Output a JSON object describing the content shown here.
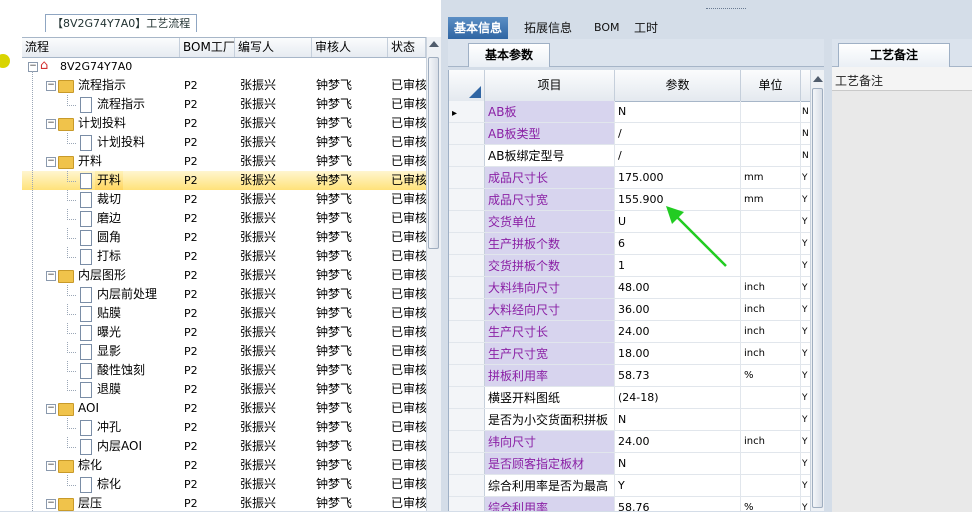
{
  "tree_panel": {
    "tab_title": "【8V2G74Y7A0】工艺流程",
    "columns": [
      "流程",
      "BOM工厂",
      "编写人",
      "审核人",
      "状态"
    ],
    "rows": [
      {
        "name": "8V2G74Y7A0",
        "level": 0,
        "kind": "root",
        "bom": "",
        "writer": "",
        "reviewer": "",
        "status": ""
      },
      {
        "name": "流程指示",
        "level": 1,
        "kind": "folder",
        "bom": "P2",
        "writer": "张振兴",
        "reviewer": "钟梦飞",
        "status": "已审核"
      },
      {
        "name": "流程指示",
        "level": 2,
        "kind": "doc",
        "bom": "P2",
        "writer": "张振兴",
        "reviewer": "钟梦飞",
        "status": "已审核"
      },
      {
        "name": "计划投料",
        "level": 1,
        "kind": "folder",
        "bom": "P2",
        "writer": "张振兴",
        "reviewer": "钟梦飞",
        "status": "已审核"
      },
      {
        "name": "计划投料",
        "level": 2,
        "kind": "doc",
        "bom": "P2",
        "writer": "张振兴",
        "reviewer": "钟梦飞",
        "status": "已审核"
      },
      {
        "name": "开料",
        "level": 1,
        "kind": "folder",
        "bom": "P2",
        "writer": "张振兴",
        "reviewer": "钟梦飞",
        "status": "已审核"
      },
      {
        "name": "开料",
        "level": 2,
        "kind": "doc",
        "bom": "P2",
        "writer": "张振兴",
        "reviewer": "钟梦飞",
        "status": "已审核",
        "selected": true
      },
      {
        "name": "裁切",
        "level": 2,
        "kind": "doc",
        "bom": "P2",
        "writer": "张振兴",
        "reviewer": "钟梦飞",
        "status": "已审核"
      },
      {
        "name": "磨边",
        "level": 2,
        "kind": "doc",
        "bom": "P2",
        "writer": "张振兴",
        "reviewer": "钟梦飞",
        "status": "已审核"
      },
      {
        "name": "圆角",
        "level": 2,
        "kind": "doc",
        "bom": "P2",
        "writer": "张振兴",
        "reviewer": "钟梦飞",
        "status": "已审核"
      },
      {
        "name": "打标",
        "level": 2,
        "kind": "doc",
        "bom": "P2",
        "writer": "张振兴",
        "reviewer": "钟梦飞",
        "status": "已审核"
      },
      {
        "name": "内层图形",
        "level": 1,
        "kind": "folder",
        "bom": "P2",
        "writer": "张振兴",
        "reviewer": "钟梦飞",
        "status": "已审核"
      },
      {
        "name": "内层前处理",
        "level": 2,
        "kind": "doc",
        "bom": "P2",
        "writer": "张振兴",
        "reviewer": "钟梦飞",
        "status": "已审核"
      },
      {
        "name": "贴膜",
        "level": 2,
        "kind": "doc",
        "bom": "P2",
        "writer": "张振兴",
        "reviewer": "钟梦飞",
        "status": "已审核"
      },
      {
        "name": "曝光",
        "level": 2,
        "kind": "doc",
        "bom": "P2",
        "writer": "张振兴",
        "reviewer": "钟梦飞",
        "status": "已审核"
      },
      {
        "name": "显影",
        "level": 2,
        "kind": "doc",
        "bom": "P2",
        "writer": "张振兴",
        "reviewer": "钟梦飞",
        "status": "已审核"
      },
      {
        "name": "酸性蚀刻",
        "level": 2,
        "kind": "doc",
        "bom": "P2",
        "writer": "张振兴",
        "reviewer": "钟梦飞",
        "status": "已审核"
      },
      {
        "name": "退膜",
        "level": 2,
        "kind": "doc",
        "bom": "P2",
        "writer": "张振兴",
        "reviewer": "钟梦飞",
        "status": "已审核"
      },
      {
        "name": "AOI",
        "level": 1,
        "kind": "folder",
        "bom": "P2",
        "writer": "张振兴",
        "reviewer": "钟梦飞",
        "status": "已审核"
      },
      {
        "name": "冲孔",
        "level": 2,
        "kind": "doc",
        "bom": "P2",
        "writer": "张振兴",
        "reviewer": "钟梦飞",
        "status": "已审核"
      },
      {
        "name": "内层AOI",
        "level": 2,
        "kind": "doc",
        "bom": "P2",
        "writer": "张振兴",
        "reviewer": "钟梦飞",
        "status": "已审核"
      },
      {
        "name": "棕化",
        "level": 1,
        "kind": "folder",
        "bom": "P2",
        "writer": "张振兴",
        "reviewer": "钟梦飞",
        "status": "已审核"
      },
      {
        "name": "棕化",
        "level": 2,
        "kind": "doc",
        "bom": "P2",
        "writer": "张振兴",
        "reviewer": "钟梦飞",
        "status": "已审核"
      },
      {
        "name": "层压",
        "level": 1,
        "kind": "folder",
        "bom": "P2",
        "writer": "张振兴",
        "reviewer": "钟梦飞",
        "status": "已审核"
      }
    ]
  },
  "main_tabs": [
    "基本信息",
    "拓展信息",
    "BOM",
    "工时"
  ],
  "sub_tab": "基本参数",
  "grid": {
    "columns": {
      "item": "项目",
      "param": "参数",
      "unit": "单位"
    },
    "rows": [
      {
        "item": "AB板",
        "param": "N",
        "unit": "",
        "flag": "N",
        "hl": true,
        "current": true
      },
      {
        "item": "AB板类型",
        "param": "/",
        "unit": "",
        "flag": "N",
        "hl": true
      },
      {
        "item": "AB板绑定型号",
        "param": "/",
        "unit": "",
        "flag": "N",
        "hl": false
      },
      {
        "item": "成品尺寸长",
        "param": "175.000",
        "unit": "mm",
        "flag": "Y",
        "hl": true
      },
      {
        "item": "成品尺寸宽",
        "param": "155.900",
        "unit": "mm",
        "flag": "Y",
        "hl": true
      },
      {
        "item": "交货单位",
        "param": "U",
        "unit": "",
        "flag": "Y",
        "hl": true
      },
      {
        "item": "生产拼板个数",
        "param": "6",
        "unit": "",
        "flag": "Y",
        "hl": true
      },
      {
        "item": "交货拼板个数",
        "param": "1",
        "unit": "",
        "flag": "Y",
        "hl": true
      },
      {
        "item": "大料纬向尺寸",
        "param": "48.00",
        "unit": "inch",
        "flag": "Y",
        "hl": true
      },
      {
        "item": "大料经向尺寸",
        "param": "36.00",
        "unit": "inch",
        "flag": "Y",
        "hl": true
      },
      {
        "item": "生产尺寸长",
        "param": "24.00",
        "unit": "inch",
        "flag": "Y",
        "hl": true
      },
      {
        "item": "生产尺寸宽",
        "param": "18.00",
        "unit": "inch",
        "flag": "Y",
        "hl": true
      },
      {
        "item": "拼板利用率",
        "param": "58.73",
        "unit": "%",
        "flag": "Y",
        "hl": true
      },
      {
        "item": "横竖开料图纸",
        "param": "(24-18)",
        "unit": "",
        "flag": "Y",
        "hl": false
      },
      {
        "item": "是否为小交货面积拼板",
        "param": "N",
        "unit": "",
        "flag": "Y",
        "hl": false
      },
      {
        "item": "纬向尺寸",
        "param": "24.00",
        "unit": "inch",
        "flag": "Y",
        "hl": true
      },
      {
        "item": "是否顾客指定板材",
        "param": "N",
        "unit": "",
        "flag": "Y",
        "hl": true
      },
      {
        "item": "综合利用率是否为最高",
        "param": "Y",
        "unit": "",
        "flag": "Y",
        "hl": false
      },
      {
        "item": "综合利用率",
        "param": "58.76",
        "unit": "%",
        "flag": "Y",
        "hl": true
      }
    ]
  },
  "notes": {
    "tab": "工艺备注",
    "label": "工艺备注"
  },
  "colors": {
    "accent": "#2f65a3",
    "highlight_text": "#8a1fa5",
    "highlight_bg": "#d7d4ee",
    "arrow": "#22cc22"
  },
  "icons": {
    "root": "house-icon",
    "folder": "folder-icon",
    "doc": "document-icon"
  }
}
